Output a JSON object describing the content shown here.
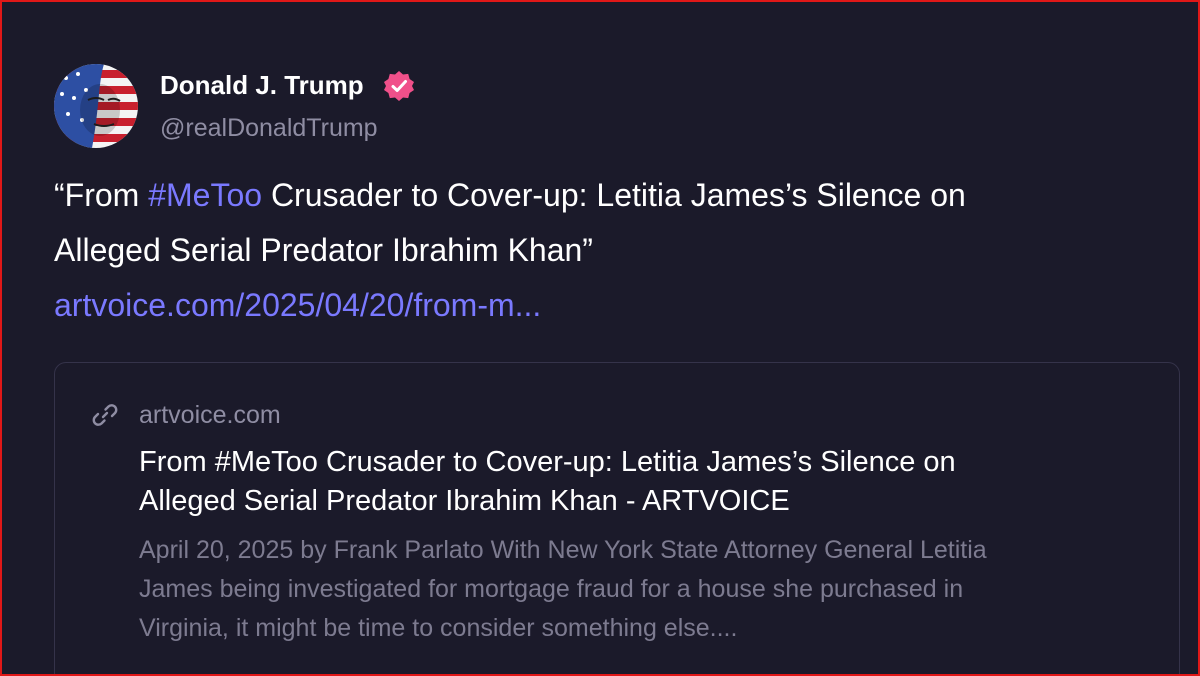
{
  "post": {
    "author_name": "Donald J. Trump",
    "author_handle": "@realDonaldTrump",
    "text_open_quote": "“From ",
    "hashtag": "#MeToo",
    "text_rest_line1": " Crusader to Cover-up: Letitia James’s Silence on",
    "text_line2": "Alleged Serial Predator Ibrahim Khan”",
    "link_text": "artvoice.com/2025/04/20/from-m..."
  },
  "link_card": {
    "domain": "artvoice.com",
    "title_line1": "From #MeToo Crusader to Cover-up: Letitia James’s Silence on",
    "title_line2": "Alleged Serial Predator Ibrahim Khan - ARTVOICE",
    "desc_line1": "April 20, 2025 by Frank Parlato With New York State Attorney General Letitia",
    "desc_line2": "James being investigated for mortgage fraud for a house she purchased in",
    "desc_line3": "Virginia, it might be time to consider something else...."
  },
  "icons": {
    "avatar": "flag-portrait-avatar",
    "verified": "verified-badge-icon",
    "link": "link-icon"
  },
  "colors": {
    "background": "#1b1a2a",
    "accent_link": "#7a79ff",
    "verified_badge": "#f0508a",
    "muted_text": "#8f8da3",
    "frame_border": "#e01818"
  }
}
